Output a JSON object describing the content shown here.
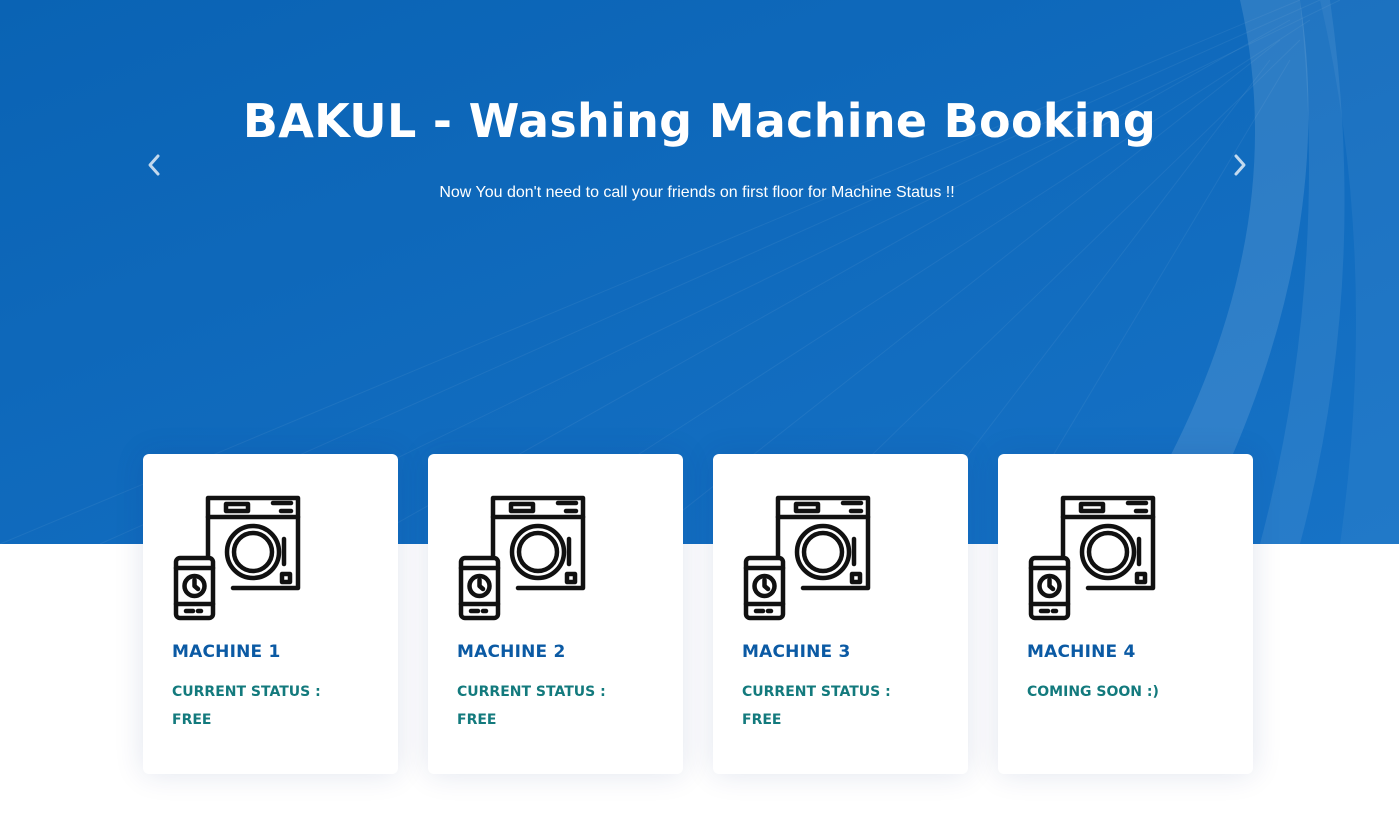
{
  "hero": {
    "title": "BAKUL - Washing Machine Booking",
    "subtitle": "Now You don't need to call your friends on first floor for Machine Status !!",
    "background_color": "#0d6bbb",
    "prev_icon": "chevron-left-icon",
    "next_icon": "chevron-right-icon"
  },
  "machines": [
    {
      "title": "MACHINE 1",
      "status_label": "CURRENT STATUS :",
      "status_value": "FREE",
      "icon": "washing-machine-phone-icon"
    },
    {
      "title": "MACHINE 2",
      "status_label": "CURRENT STATUS :",
      "status_value": "FREE",
      "icon": "washing-machine-phone-icon"
    },
    {
      "title": "MACHINE 3",
      "status_label": "CURRENT STATUS :",
      "status_value": "FREE",
      "icon": "washing-machine-phone-icon"
    },
    {
      "title": "MACHINE 4",
      "status_label": "COMING SOON :)",
      "status_value": "",
      "icon": "washing-machine-phone-icon"
    }
  ],
  "colors": {
    "card_title": "#0b5aa4",
    "card_status": "#137a7d"
  }
}
